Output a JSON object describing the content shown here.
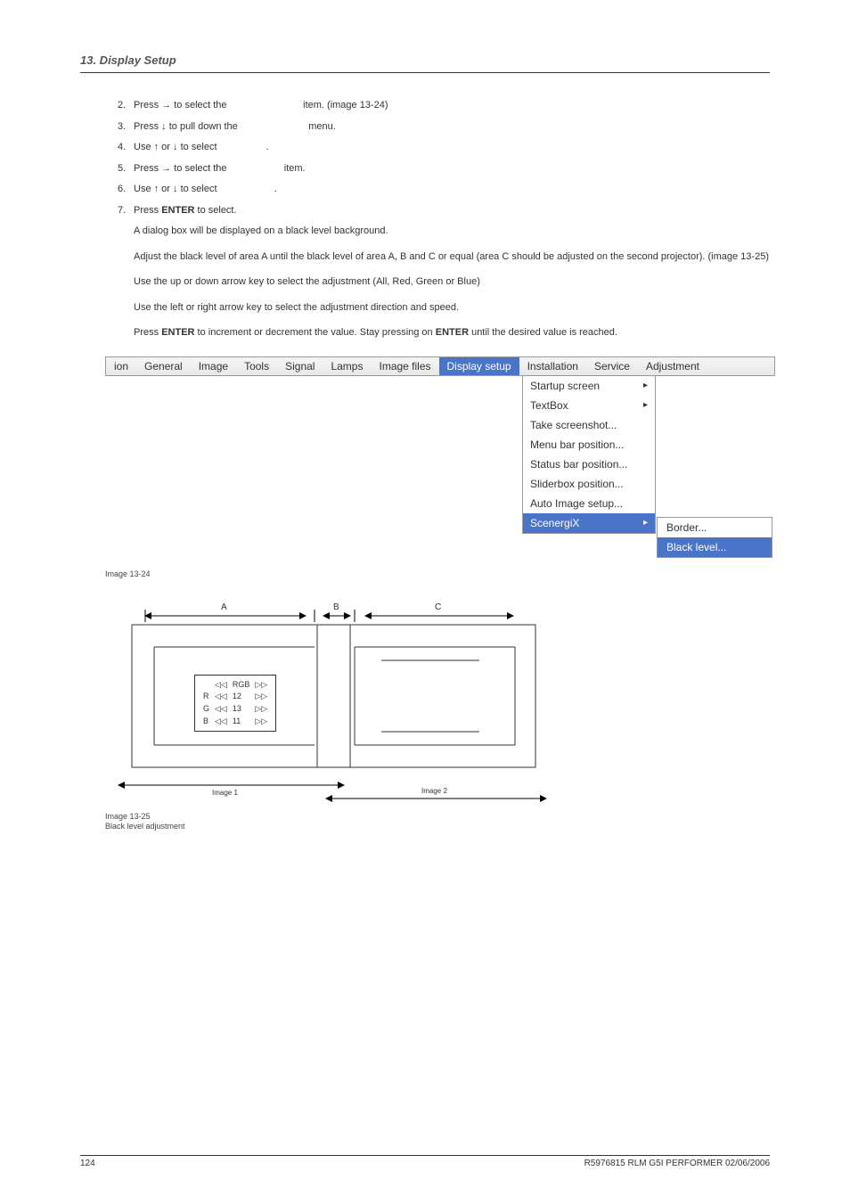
{
  "header": {
    "section": "13.  Display Setup"
  },
  "steps": [
    {
      "n": "2.",
      "pre": "Press → to select the ",
      "post": " item.  (image 13-24)"
    },
    {
      "n": "3.",
      "pre": "Press ↓ to pull down the ",
      "post": " menu."
    },
    {
      "n": "4.",
      "pre": "Use ↑ or ↓ to select ",
      "post": " ."
    },
    {
      "n": "5.",
      "pre": "Press → to select the ",
      "post": " item."
    },
    {
      "n": "6.",
      "pre": "Use ↑ or ↓ to select ",
      "post": " ."
    },
    {
      "n": "7.",
      "pre": "Press ",
      "bold": "ENTER",
      "post": " to select."
    }
  ],
  "paras": {
    "p1": "A dialog box will be displayed on a black level background.",
    "p2": "Adjust the black level of area A until the black level of area A, B and C or equal (area C should be adjusted on the second projector).  (image 13-25)",
    "p3": "Use the up or down arrow key to select the adjustment (All, Red, Green or Blue)",
    "p4": "Use the left or right arrow key to select the adjustment direction and speed.",
    "p5a": "Press ",
    "p5b": "ENTER",
    "p5c": " to increment or decrement the value.  Stay pressing on ",
    "p5d": "ENTER",
    "p5e": " until the desired value is reached."
  },
  "menu": {
    "items": [
      "ion",
      "General",
      "Image",
      "Tools",
      "Signal",
      "Lamps",
      "Image files",
      "Display setup",
      "Installation",
      "Service",
      "Adjustment"
    ],
    "active": "Display setup",
    "dropdown": [
      {
        "label": "Startup screen",
        "arrow": true
      },
      {
        "label": "TextBox",
        "arrow": true
      },
      {
        "label": "Take screenshot..."
      },
      {
        "label": "Menu bar position..."
      },
      {
        "label": "Status bar position..."
      },
      {
        "label": "Sliderbox position..."
      },
      {
        "label": "Auto Image setup..."
      },
      {
        "label": "ScenergiX",
        "arrow": true,
        "active": true
      }
    ],
    "submenu": [
      {
        "label": "Border..."
      },
      {
        "label": "Black level...",
        "active": true
      }
    ]
  },
  "captions": {
    "img1": "Image 13-24",
    "img2a": "Image 13-25",
    "img2b": "Black level adjustment"
  },
  "diagram": {
    "A": "A",
    "B": "B",
    "C": "C",
    "rgb_header": "RGB",
    "rows": [
      {
        "c": "R",
        "v": "12"
      },
      {
        "c": "G",
        "v": "13"
      },
      {
        "c": "B",
        "v": "11"
      }
    ],
    "tri_l": "◁◁",
    "tri_r": "▷▷",
    "img1": "Image 1",
    "img2": "Image 2"
  },
  "footer": {
    "page": "124",
    "right": "R5976815  RLM G5I PERFORMER  02/06/2006"
  }
}
